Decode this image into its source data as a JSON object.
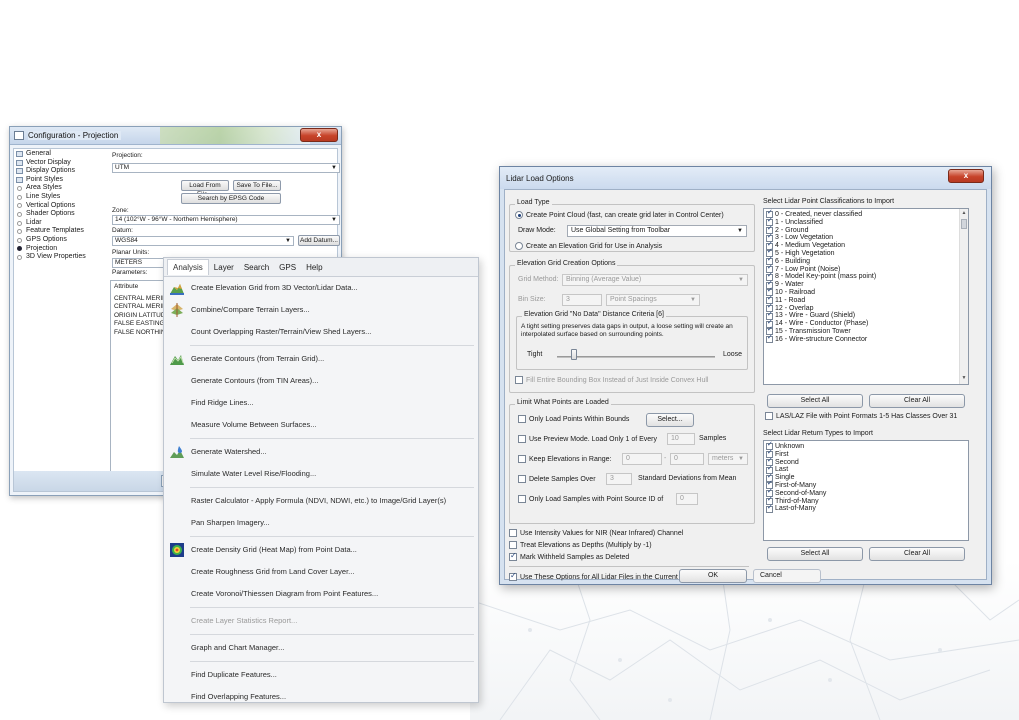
{
  "config_window": {
    "title": "Configuration - Projection",
    "close": "x",
    "tree": [
      {
        "label": "General",
        "kind": "folder"
      },
      {
        "label": "Vector Display",
        "kind": "folder"
      },
      {
        "label": "Display Options",
        "kind": "folder"
      },
      {
        "label": "Point Styles",
        "kind": "folder"
      },
      {
        "label": "Area Styles",
        "kind": "bullet"
      },
      {
        "label": "Line Styles",
        "kind": "bullet"
      },
      {
        "label": "Vertical Options",
        "kind": "bullet"
      },
      {
        "label": "Shader Options",
        "kind": "bullet"
      },
      {
        "label": "Lidar",
        "kind": "bullet"
      },
      {
        "label": "Feature Templates",
        "kind": "bullet"
      },
      {
        "label": "GPS Options",
        "kind": "bullet"
      },
      {
        "label": "Projection",
        "kind": "selected"
      },
      {
        "label": "3D View Properties",
        "kind": "bullet"
      }
    ],
    "projection_label": "Projection:",
    "projection_value": "UTM",
    "load_from_file": "Load From File...",
    "save_to_file": "Save To File...",
    "search_epsg": "Search by EPSG Code",
    "zone_label": "Zone:",
    "zone_value": "14 (102°W - 96°W - Northern Hemisphere)",
    "datum_label": "Datum:",
    "datum_value": "WGS84",
    "add_datum": "Add Datum...",
    "planar_units_label": "Planar Units:",
    "planar_units_value": "METERS",
    "parameters_label": "Parameters:",
    "attributes": [
      "Attribute",
      "CENTRAL MERID",
      "CENTRAL MERID",
      "ORIGIN LATITUD",
      "FALSE EASTING",
      "FALSE NORTHIN"
    ]
  },
  "analysis_menu": {
    "tabs": [
      "Analysis",
      "Layer",
      "Search",
      "GPS",
      "Help"
    ],
    "items": [
      {
        "label": "Create Elevation Grid from 3D Vector/Lidar Data...",
        "icon": "elevation-grid-icon",
        "disabled": false
      },
      {
        "label": "Combine/Compare Terrain Layers...",
        "icon": "terrain-compare-icon",
        "disabled": false
      },
      {
        "label": "Count Overlapping Raster/Terrain/View Shed Layers...",
        "icon": "",
        "disabled": false
      },
      {
        "sep": true
      },
      {
        "label": "Generate Contours (from Terrain Grid)...",
        "icon": "contours-icon",
        "disabled": false
      },
      {
        "label": "Generate Contours (from TIN Areas)...",
        "icon": "",
        "disabled": false
      },
      {
        "label": "Find Ridge Lines...",
        "icon": "",
        "disabled": false
      },
      {
        "label": "Measure Volume Between Surfaces...",
        "icon": "",
        "disabled": false
      },
      {
        "sep": true
      },
      {
        "label": "Generate Watershed...",
        "icon": "watershed-icon",
        "disabled": false
      },
      {
        "label": "Simulate Water Level Rise/Flooding...",
        "icon": "",
        "disabled": false
      },
      {
        "sep": true
      },
      {
        "label": "Raster Calculator - Apply Formula (NDVI, NDWI, etc.) to Image/Grid Layer(s)",
        "icon": "",
        "disabled": false
      },
      {
        "label": "Pan Sharpen Imagery...",
        "icon": "",
        "disabled": false
      },
      {
        "sep": true
      },
      {
        "label": "Create Density Grid (Heat Map) from Point Data...",
        "icon": "density-grid-icon",
        "disabled": false
      },
      {
        "label": "Create Roughness Grid from Land Cover Layer...",
        "icon": "",
        "disabled": false
      },
      {
        "label": "Create Voronoi/Thiessen Diagram from Point Features...",
        "icon": "",
        "disabled": false
      },
      {
        "sep": true
      },
      {
        "label": "Create Layer Statistics Report...",
        "icon": "",
        "disabled": true
      },
      {
        "sep": true
      },
      {
        "label": "Graph and Chart Manager...",
        "icon": "",
        "disabled": false
      },
      {
        "sep": true
      },
      {
        "label": "Find Duplicate Features...",
        "icon": "",
        "disabled": false
      },
      {
        "label": "Find Overlapping Features...",
        "icon": "",
        "disabled": false
      }
    ]
  },
  "lidar_dialog": {
    "title": "Lidar Load Options",
    "close": "x",
    "load_type": {
      "group": "Load Type",
      "point_cloud": "Create Point Cloud (fast, can create grid later in Control Center)",
      "draw_mode_label": "Draw Mode:",
      "draw_mode_value": "Use Global Setting from Toolbar",
      "elevation_grid": "Create an Elevation Grid for Use in Analysis"
    },
    "grid_options": {
      "group": "Elevation Grid Creation Options",
      "method_label": "Grid Method:",
      "method_value": "Binning (Average Value)",
      "bin_size_label": "Bin Size:",
      "bin_size_value": "3",
      "bin_units": "Point Spacings",
      "nodata_group": "Elevation Grid \"No Data\" Distance Criteria [6]",
      "nodata_text": "A tight setting preserves data gaps in output, a loose setting will create an interpolated surface based on surrounding points.",
      "tight": "Tight",
      "loose": "Loose",
      "fill_bbox": "Fill Entire Bounding Box Instead of Just Inside Convex Hull"
    },
    "limit": {
      "group": "Limit What Points are Loaded",
      "within_bounds": "Only Load Points Within Bounds",
      "select_btn": "Select...",
      "preview_mode": "Use Preview Mode. Load Only 1 of Every",
      "preview_value": "10",
      "samples": "Samples",
      "keep_elev": "Keep Elevations in Range:",
      "elev_min": "0",
      "elev_dash": "-",
      "elev_max": "0",
      "elev_units": "meters",
      "delete_over": "Delete Samples Over",
      "delete_value": "3",
      "std_dev": "Standard Deviations from Mean",
      "source_id": "Only Load Samples with Point Source ID of",
      "source_id_value": "0"
    },
    "intensity_nir": "Use Intensity Values for NIR (Near Infrared) Channel",
    "treat_depths": "Treat Elevations as Depths (Multiply by -1)",
    "mark_withheld": "Mark Withheld Samples as Deleted",
    "use_for_all": "Use These Options for All Lidar Files in the Current Group",
    "ok": "OK",
    "cancel": "Cancel",
    "classes": {
      "group": "Select Lidar Point Classifications to Import",
      "items": [
        "0 - Created, never classified",
        "1 - Unclassified",
        "2 - Ground",
        "3 - Low Vegetation",
        "4 - Medium Vegetation",
        "5 - High Vegetation",
        "6 - Building",
        "7 - Low Point (Noise)",
        "8 - Model Key-point (mass point)",
        "9 - Water",
        "10 - Railroad",
        "11 - Road",
        "12 - Overlap",
        "13 - Wire - Guard (Shield)",
        "14 - Wire - Conductor (Phase)",
        "15 - Transmission Tower",
        "16 - Wire-structure Connector"
      ],
      "select_all": "Select All",
      "clear_all": "Clear All",
      "las_note": "LAS/LAZ File with Point Formats 1-5 Has Classes Over 31"
    },
    "returns": {
      "group": "Select Lidar Return Types to Import",
      "items": [
        "Unknown",
        "First",
        "Second",
        "Last",
        "Single",
        "First-of-Many",
        "Second-of-Many",
        "Third-of-Many",
        "Last-of-Many"
      ],
      "select_all": "Select All",
      "clear_all": "Clear All"
    }
  }
}
